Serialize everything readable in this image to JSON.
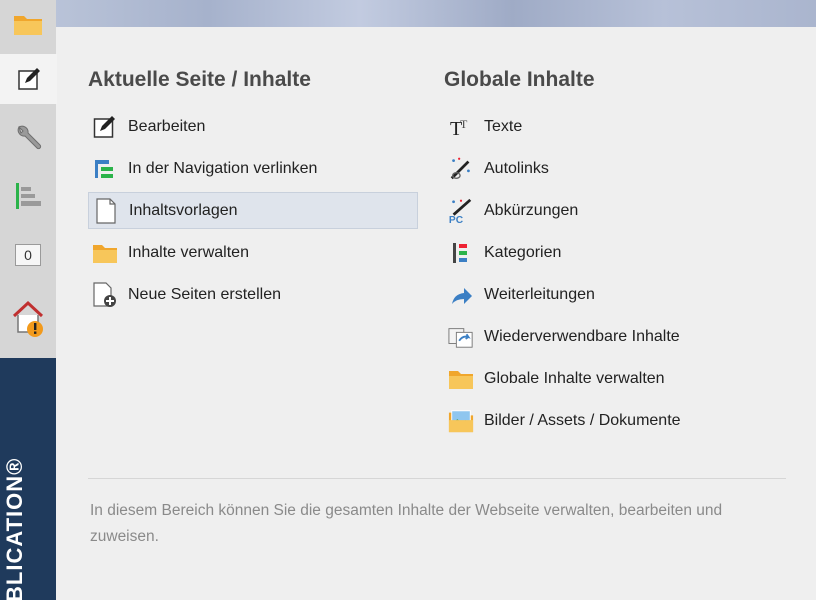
{
  "sidebar": {
    "counter": "0",
    "brand": "BLICATION®",
    "icons": [
      "folder-icon",
      "edit-icon",
      "wrench-icon",
      "structure-icon",
      "home-warning-icon"
    ]
  },
  "left_column": {
    "title": "Aktuelle Seite / Inhalte",
    "items": [
      {
        "label": "Bearbeiten",
        "icon": "pencil-icon"
      },
      {
        "label": "In der Navigation verlinken",
        "icon": "tree-icon"
      },
      {
        "label": "Inhaltsvorlagen",
        "icon": "page-icon",
        "highlighted": true
      },
      {
        "label": "Inhalte verwalten",
        "icon": "folder-icon"
      },
      {
        "label": "Neue Seiten erstellen",
        "icon": "new-page-icon"
      }
    ]
  },
  "right_column": {
    "title": "Globale Inhalte",
    "items": [
      {
        "label": "Texte",
        "icon": "text-icon"
      },
      {
        "label": "Autolinks",
        "icon": "magic-link-icon"
      },
      {
        "label": "Abkürzungen",
        "icon": "magic-abbr-icon"
      },
      {
        "label": "Kategorien",
        "icon": "categories-icon"
      },
      {
        "label": "Weiterleitungen",
        "icon": "redirect-icon"
      },
      {
        "label": "Wiederverwendbare Inhalte",
        "icon": "reuse-icon"
      },
      {
        "label": "Globale Inhalte verwalten",
        "icon": "folder-icon"
      },
      {
        "label": "Bilder / Assets / Dokumente",
        "icon": "image-icon"
      }
    ]
  },
  "description": "In diesem Bereich können Sie die gesamten Inhalte der Webseite verwalten, bearbeiten und zuweisen.",
  "colors": {
    "sidebar_dark": "#1f3a5c",
    "highlight": "#dfe4ec",
    "folder": "#f2b43a"
  }
}
